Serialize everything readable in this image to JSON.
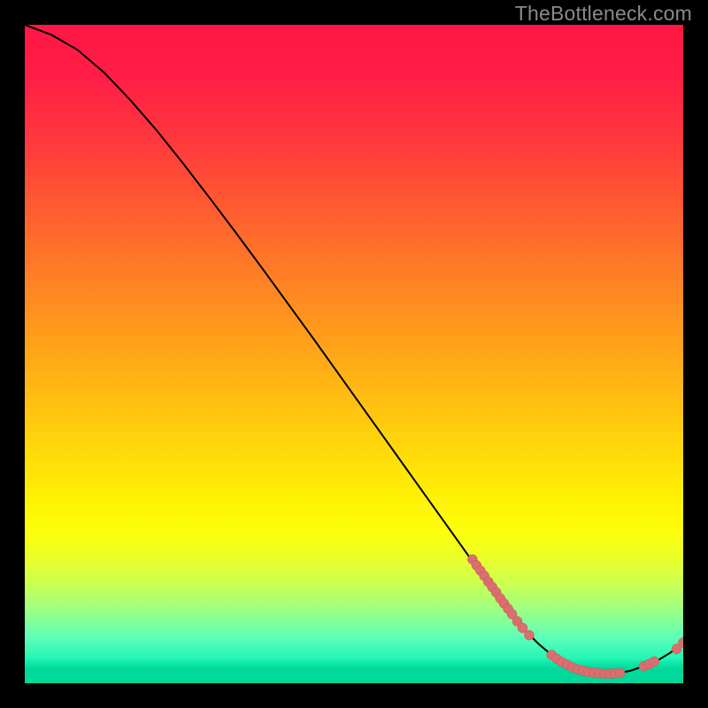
{
  "watermark": "TheBottleneck.com",
  "chart_data": {
    "type": "line",
    "title": "",
    "xlabel": "",
    "ylabel": "",
    "xlim": [
      0,
      100
    ],
    "ylim": [
      0,
      100
    ],
    "background": "red-yellow-green vertical gradient (red high, green low)",
    "series": [
      {
        "name": "bottleneck-curve",
        "x": [
          0,
          4,
          8,
          12,
          16,
          20,
          24,
          28,
          32,
          36,
          40,
          44,
          48,
          52,
          56,
          60,
          64,
          68,
          72,
          74,
          76,
          78,
          80,
          82,
          84,
          86,
          88,
          90,
          92,
          94,
          96,
          98,
          100
        ],
        "y": [
          100,
          98.5,
          96.2,
          92.8,
          88.6,
          84.0,
          79.0,
          73.8,
          68.5,
          63.1,
          57.6,
          52.1,
          46.5,
          40.9,
          35.3,
          29.7,
          24.1,
          18.5,
          12.9,
          10.3,
          8.0,
          6.0,
          4.3,
          3.0,
          2.1,
          1.6,
          1.4,
          1.5,
          1.9,
          2.6,
          3.4,
          4.6,
          6.2
        ]
      }
    ],
    "points": [
      {
        "x": 68.0,
        "y": 18.8
      },
      {
        "x": 68.6,
        "y": 17.9
      },
      {
        "x": 69.2,
        "y": 17.1
      },
      {
        "x": 69.8,
        "y": 16.3
      },
      {
        "x": 70.4,
        "y": 15.4
      },
      {
        "x": 71.0,
        "y": 14.6
      },
      {
        "x": 71.6,
        "y": 13.8
      },
      {
        "x": 72.2,
        "y": 12.9
      },
      {
        "x": 72.8,
        "y": 12.1
      },
      {
        "x": 73.4,
        "y": 11.3
      },
      {
        "x": 74.0,
        "y": 10.5
      },
      {
        "x": 74.8,
        "y": 9.4
      },
      {
        "x": 75.6,
        "y": 8.4
      },
      {
        "x": 76.6,
        "y": 7.3
      },
      {
        "x": 80.0,
        "y": 4.3
      },
      {
        "x": 80.8,
        "y": 3.7
      },
      {
        "x": 81.6,
        "y": 3.2
      },
      {
        "x": 82.4,
        "y": 2.8
      },
      {
        "x": 83.2,
        "y": 2.4
      },
      {
        "x": 84.0,
        "y": 2.1
      },
      {
        "x": 84.8,
        "y": 1.9
      },
      {
        "x": 85.6,
        "y": 1.7
      },
      {
        "x": 86.4,
        "y": 1.6
      },
      {
        "x": 87.2,
        "y": 1.5
      },
      {
        "x": 88.0,
        "y": 1.45
      },
      {
        "x": 88.8,
        "y": 1.45
      },
      {
        "x": 89.6,
        "y": 1.5
      },
      {
        "x": 90.4,
        "y": 1.55
      },
      {
        "x": 94.0,
        "y": 2.6
      },
      {
        "x": 94.8,
        "y": 2.9
      },
      {
        "x": 95.6,
        "y": 3.3
      },
      {
        "x": 99.0,
        "y": 5.2
      },
      {
        "x": 100.0,
        "y": 6.2
      }
    ]
  }
}
